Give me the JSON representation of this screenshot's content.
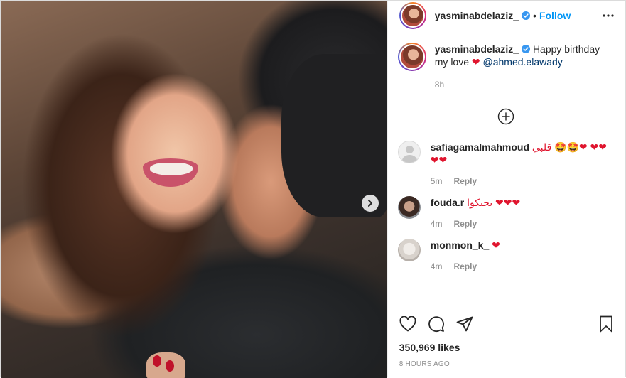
{
  "post": {
    "author": "yasminabdelaziz_",
    "follow_label": "Follow",
    "dot": "•",
    "caption": {
      "text_line1": "Happy birthday",
      "text_line2": "my love",
      "heart": "❤",
      "mention": "@ahmed.elawady",
      "time": "8h"
    },
    "image_alt": "Photo of a man kissing a smiling woman on the cheek"
  },
  "comments": [
    {
      "username": "safiagamalmahmoud",
      "text": "قلبي 🤩🤩❤ ❤❤❤❤",
      "time": "5m",
      "reply": "Reply",
      "avatar": "default-avatar"
    },
    {
      "username": "fouda.r",
      "text": "بحبكوا ❤❤❤",
      "time": "4m",
      "reply": "Reply",
      "avatar": "photo-avatar"
    },
    {
      "username": "monmon_k_",
      "text": "❤",
      "time": "4m",
      "reply": "Reply",
      "avatar": "photo-avatar"
    }
  ],
  "footer": {
    "likes": "350,969 likes",
    "posted": "8 HOURS AGO"
  },
  "icons": {
    "like": "heart-icon",
    "comment": "comment-icon",
    "share": "paper-plane-icon",
    "save": "bookmark-icon",
    "more": "more-options-icon",
    "load_more": "plus-circle-icon",
    "next": "chevron-right-icon",
    "verified": "verified-badge-icon"
  },
  "colors": {
    "accent": "#0095f6",
    "heart": "#e0152e",
    "muted": "#8e8e8e",
    "mention": "#00376b"
  }
}
